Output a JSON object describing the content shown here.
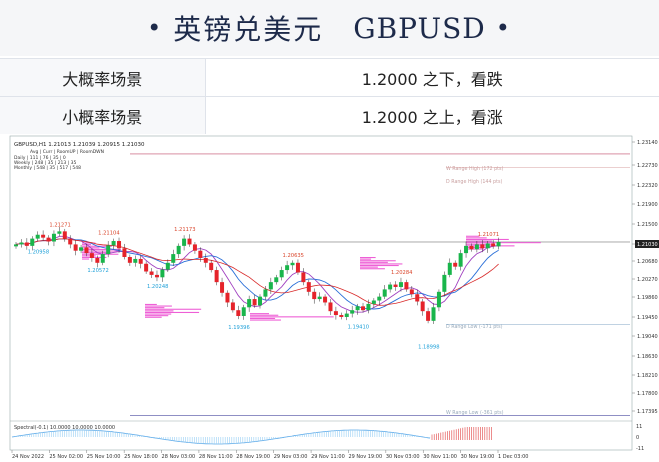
{
  "header": {
    "title_cn": "英镑兑美元",
    "title_en": "GBPUSD",
    "bullet": "•"
  },
  "scenarios": [
    {
      "label": "大概率场景",
      "value": "1.2000 之下，看跌"
    },
    {
      "label": "小概率场景",
      "value": "1.2000 之上，看涨"
    }
  ],
  "chart": {
    "ohlc_line": "GBPUSD,H1  1.21013 1.21039 1.20915 1.21030",
    "info_line_1": "Avg | Curr | RoomUP | RoomDWN",
    "info_line_2": "Daily | 111 | 76 | 35 | 0",
    "info_line_3": "Weekly | 248 | 35 | 213 | 35",
    "info_line_4": "Monthly | 548 | 35 | 517 | 548",
    "oscillator_label": "Spectral(-0.1) 10.0000 10.0000 10.0000",
    "current_price": "1.21030",
    "price_ticks": [
      "1.23140",
      "1.22730",
      "1.22320",
      "1.21900",
      "1.21500",
      "1.21030",
      "1.20680",
      "1.20270",
      "1.19860",
      "1.19450",
      "1.19040",
      "1.18630",
      "1.18210",
      "1.17800",
      "1.17395"
    ],
    "time_ticks": [
      "24 Nov 2022",
      "25 Nov 02:00",
      "25 Nov 10:00",
      "25 Nov 18:00",
      "28 Nov 03:00",
      "28 Nov 11:00",
      "28 Nov 19:00",
      "29 Nov 03:00",
      "29 Nov 11:00",
      "29 Nov 19:00",
      "30 Nov 03:00",
      "30 Nov 11:00",
      "30 Nov 19:00",
      "1 Dec 03:00"
    ],
    "osc_ticks": [
      "11",
      "0",
      "-11"
    ],
    "range_labels": {
      "high_72": "W Range High (172 pts)",
      "high_44": "D Range High (144 pts)",
      "low_71": "D Range Low (-171 pts)",
      "low_361": "W Range Low (-361 pts)"
    },
    "price_annotations": [
      {
        "text": "1.21271",
        "color": "#d9452b",
        "price": 1.21271,
        "bar": 8
      },
      {
        "text": "1.20958",
        "color": "#1fa0d8",
        "price": 1.20958,
        "bar": 4
      },
      {
        "text": "1.21104",
        "color": "#d9452b",
        "price": 1.21104,
        "bar": 17
      },
      {
        "text": "1.20572",
        "color": "#1fa0d8",
        "price": 1.20572,
        "bar": 15
      },
      {
        "text": "1.21173",
        "color": "#d9452b",
        "price": 1.21173,
        "bar": 31
      },
      {
        "text": "1.20248",
        "color": "#1fa0d8",
        "price": 1.20248,
        "bar": 26
      },
      {
        "text": "1.19396",
        "color": "#1fa0d8",
        "price": 1.19396,
        "bar": 41
      },
      {
        "text": "1.20635",
        "color": "#d9452b",
        "price": 1.20635,
        "bar": 51
      },
      {
        "text": "1.19410",
        "color": "#1fa0d8",
        "price": 1.1941,
        "bar": 63
      },
      {
        "text": "1.20284",
        "color": "#d9452b",
        "price": 1.20284,
        "bar": 71
      },
      {
        "text": "1.18998",
        "color": "#1fa0d8",
        "price": 1.18998,
        "bar": 76
      },
      {
        "text": "1.21071",
        "color": "#d9452b",
        "price": 1.21071,
        "bar": 87
      }
    ]
  },
  "chart_data": {
    "type": "candlestick",
    "symbol": "GBPUSD",
    "timeframe": "H1",
    "ylim": [
      1.1735,
      1.2318
    ],
    "grid": false,
    "levels": {
      "w_range_high": 1.2285,
      "d_range_high": 1.2257,
      "current": 1.2103,
      "d_range_low": 1.1932,
      "w_range_low": 1.1744
    },
    "closes": [
      1.2098,
      1.2102,
      1.2095,
      1.211,
      1.2118,
      1.2112,
      1.2104,
      1.212,
      1.2125,
      1.211,
      1.2098,
      1.2085,
      1.2092,
      1.208,
      1.207,
      1.206,
      1.2078,
      1.2096,
      1.2105,
      1.209,
      1.2072,
      1.206,
      1.2068,
      1.2058,
      1.2042,
      1.2035,
      1.203,
      1.2046,
      1.206,
      1.2078,
      1.2095,
      1.211,
      1.2098,
      1.2085,
      1.207,
      1.206,
      1.2045,
      1.202,
      1.1998,
      1.1978,
      1.1962,
      1.195,
      1.1968,
      1.1985,
      1.1972,
      1.199,
      1.2005,
      1.202,
      1.203,
      1.2045,
      1.2055,
      1.206,
      1.204,
      1.202,
      1.2,
      1.1985,
      1.199,
      1.1978,
      1.196,
      1.1952,
      1.1948,
      1.1955,
      1.1962,
      1.197,
      1.1962,
      1.1975,
      1.1982,
      1.199,
      1.2005,
      1.2015,
      1.201,
      1.202,
      1.2005,
      1.1995,
      1.198,
      1.196,
      1.194,
      1.1968,
      1.2,
      1.2035,
      1.206,
      1.2052,
      1.208,
      1.2095,
      1.2088,
      1.2098,
      1.209,
      1.21,
      1.2094,
      1.2103
    ]
  }
}
